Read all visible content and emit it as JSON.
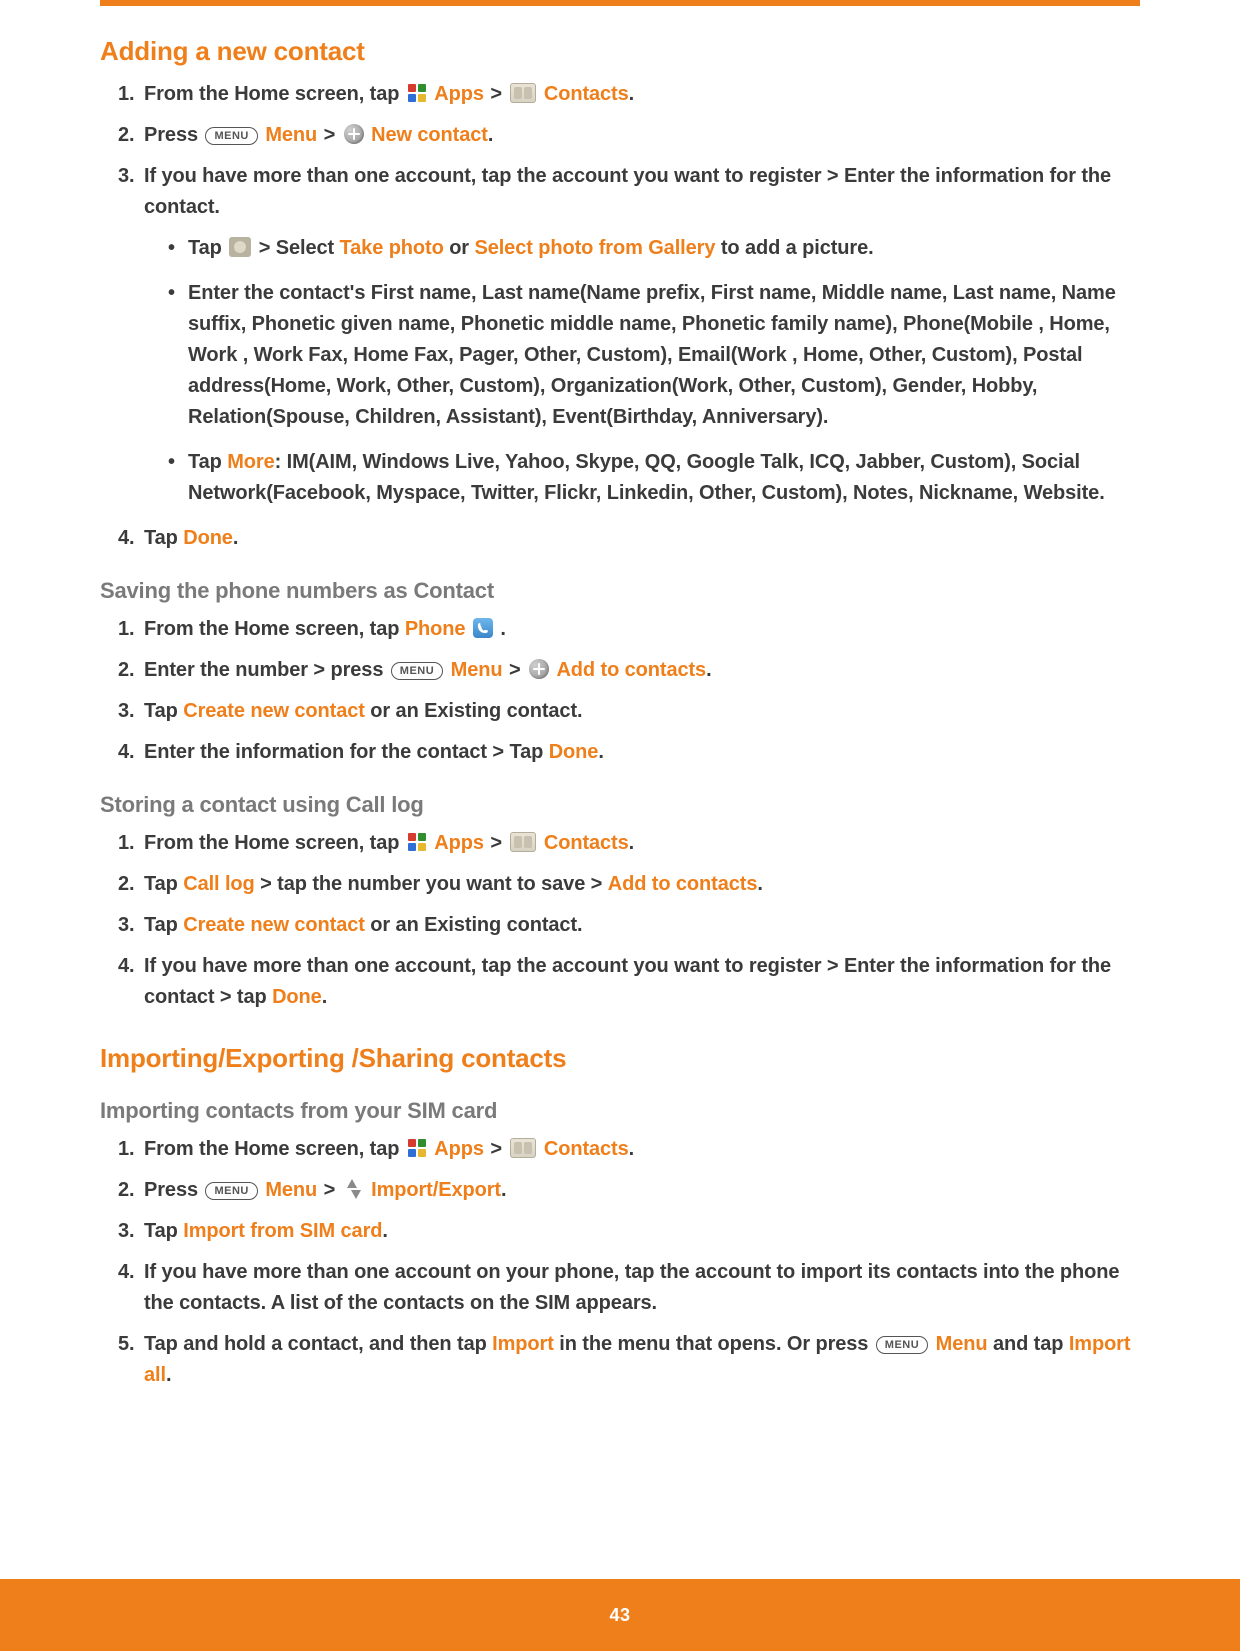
{
  "icons": {
    "menu_label": "MENU"
  },
  "page_number": "43",
  "s1": {
    "heading": "Adding a new contact",
    "li1_a": "From the Home screen, tap ",
    "li1_apps": "Apps",
    "li1_sep": " > ",
    "li1_contacts": "Contacts",
    "li1_end": ".",
    "li2_a": "Press ",
    "li2_menu": "Menu",
    "li2_sep": " > ",
    "li2_new": "New contact",
    "li2_end": ".",
    "li3": "If you have more than one account, tap the account you want to register > Enter the information for the contact.",
    "b1_a": "Tap ",
    "b1_b": " > Select ",
    "b1_take": "Take photo",
    "b1_or": " or ",
    "b1_gal": "Select photo from Gallery",
    "b1_end": " to add a picture.",
    "b2": "Enter the contact's First name, Last name(Name prefix, First name, Middle name, Last name, Name suffix, Phonetic given name, Phonetic middle name, Phonetic family name),  Phone(Mobile , Home, Work , Work Fax, Home Fax, Pager, Other, Custom), Email(Work , Home, Other, Custom), Postal address(Home, Work, Other, Custom), Organization(Work, Other, Custom), Gender, Hobby, Relation(Spouse, Children, Assistant), Event(Birthday, Anniversary).",
    "b3_a": "Tap ",
    "b3_more": "More",
    "b3_rest": ": IM(AIM, Windows Live, Yahoo, Skype, QQ, Google Talk, ICQ,  Jabber,  Custom), Social Network(Facebook, Myspace, Twitter, Flickr, Linkedin, Other, Custom), Notes, Nickname, Website.",
    "li4_a": "Tap ",
    "li4_done": "Done",
    "li4_end": "."
  },
  "s2": {
    "heading": "Saving the phone numbers as Contact",
    "li1_a": "From the Home screen, tap ",
    "li1_phone": "Phone",
    "li1_end": " .",
    "li2_a": "Enter the number > press ",
    "li2_menu": "Menu",
    "li2_sep": " > ",
    "li2_add": "Add to contacts",
    "li2_end": ".",
    "li3_a": "Tap ",
    "li3_create": "Create new contact",
    "li3_rest": " or an Existing contact.",
    "li4_a": "Enter the information for the contact > Tap ",
    "li4_done": "Done",
    "li4_end": "."
  },
  "s3": {
    "heading": "Storing a contact using Call log",
    "li1_a": "From the Home screen, tap ",
    "li1_apps": "Apps",
    "li1_sep": " > ",
    "li1_contacts": "Contacts",
    "li1_end": ".",
    "li2_a": "Tap ",
    "li2_calllog": "Call log",
    "li2_mid": " > tap the number you want to save > ",
    "li2_add": "Add to contacts",
    "li2_end": ".",
    "li3_a": "Tap ",
    "li3_create": "Create new contact",
    "li3_rest": " or an Existing contact.",
    "li4_a": "If you have more than one account, tap the account you want to register > Enter the information for the contact > tap ",
    "li4_done": "Done",
    "li4_end": "."
  },
  "s4": {
    "heading": "Importing/Exporting /Sharing contacts",
    "sub": "Importing contacts from your SIM card",
    "li1_a": "From the Home screen, tap ",
    "li1_apps": "Apps",
    "li1_sep": " > ",
    "li1_contacts": "Contacts",
    "li1_end": ".",
    "li2_a": "Press ",
    "li2_menu": "Menu",
    "li2_sep": " > ",
    "li2_imp": "Import/Export",
    "li2_end": ".",
    "li3_a": "Tap ",
    "li3_sim": "Import from SIM card",
    "li3_end": ".",
    "li4": "If you have more than one account on your phone, tap the account to import its contacts into the phone the contacts. A list of the contacts on the SIM appears.",
    "li5_a": "Tap and hold a contact, and then tap ",
    "li5_import": "Import",
    "li5_mid": " in the menu that opens. Or press ",
    "li5_menu": "Menu",
    "li5_and": " and tap ",
    "li5_all": "Import all",
    "li5_end": "."
  }
}
